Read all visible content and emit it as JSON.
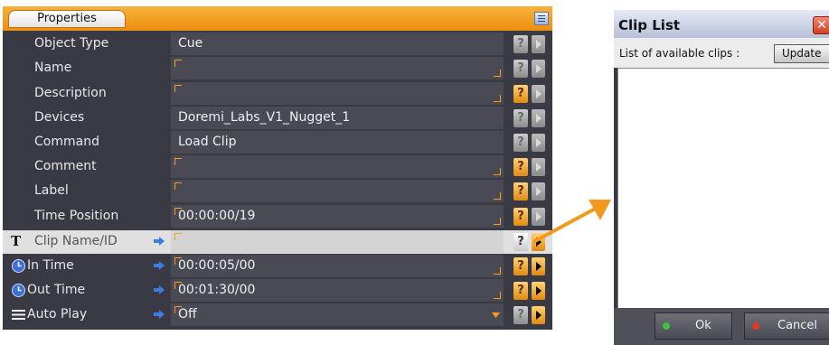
{
  "properties": {
    "tab_label": "Properties",
    "rows": [
      {
        "label": "Object Type",
        "value": "Cue",
        "help": "?"
      },
      {
        "label": "Name",
        "value": "",
        "help": "?"
      },
      {
        "label": "Description",
        "value": "",
        "help": "?"
      },
      {
        "label": "Devices",
        "value": "Doremi_Labs_V1_Nugget_1",
        "help": "?"
      },
      {
        "label": "Command",
        "value": "Load Clip",
        "help": "?"
      },
      {
        "label": "Comment",
        "value": "",
        "help": "?"
      },
      {
        "label": "Label",
        "value": "",
        "help": "?"
      },
      {
        "label": "Time Position",
        "value": "00:00:00/19",
        "help": "?"
      },
      {
        "label": "Clip Name/ID",
        "value": "",
        "help": "?",
        "icon": "text-type-icon",
        "icon_text": "T"
      },
      {
        "label": "In Time",
        "value": "00:00:05/00",
        "help": "?",
        "icon": "clock-icon"
      },
      {
        "label": "Out Time",
        "value": "00:01:30/00",
        "help": "?",
        "icon": "clock-icon"
      },
      {
        "label": "Auto Play",
        "value": "Off",
        "help": "?",
        "icon": "list-icon"
      }
    ]
  },
  "clip_list": {
    "title": "Clip List",
    "close_glyph": "✕",
    "subtitle": "List of available clips :",
    "update_label": "Update",
    "ok_label": "Ok",
    "cancel_label": "Cancel"
  },
  "colors": {
    "accent_orange": "#ef8e10",
    "panel_bg": "#3a3a44",
    "ok_dot": "#3cc23c",
    "cancel_dot": "#e03a2a"
  }
}
